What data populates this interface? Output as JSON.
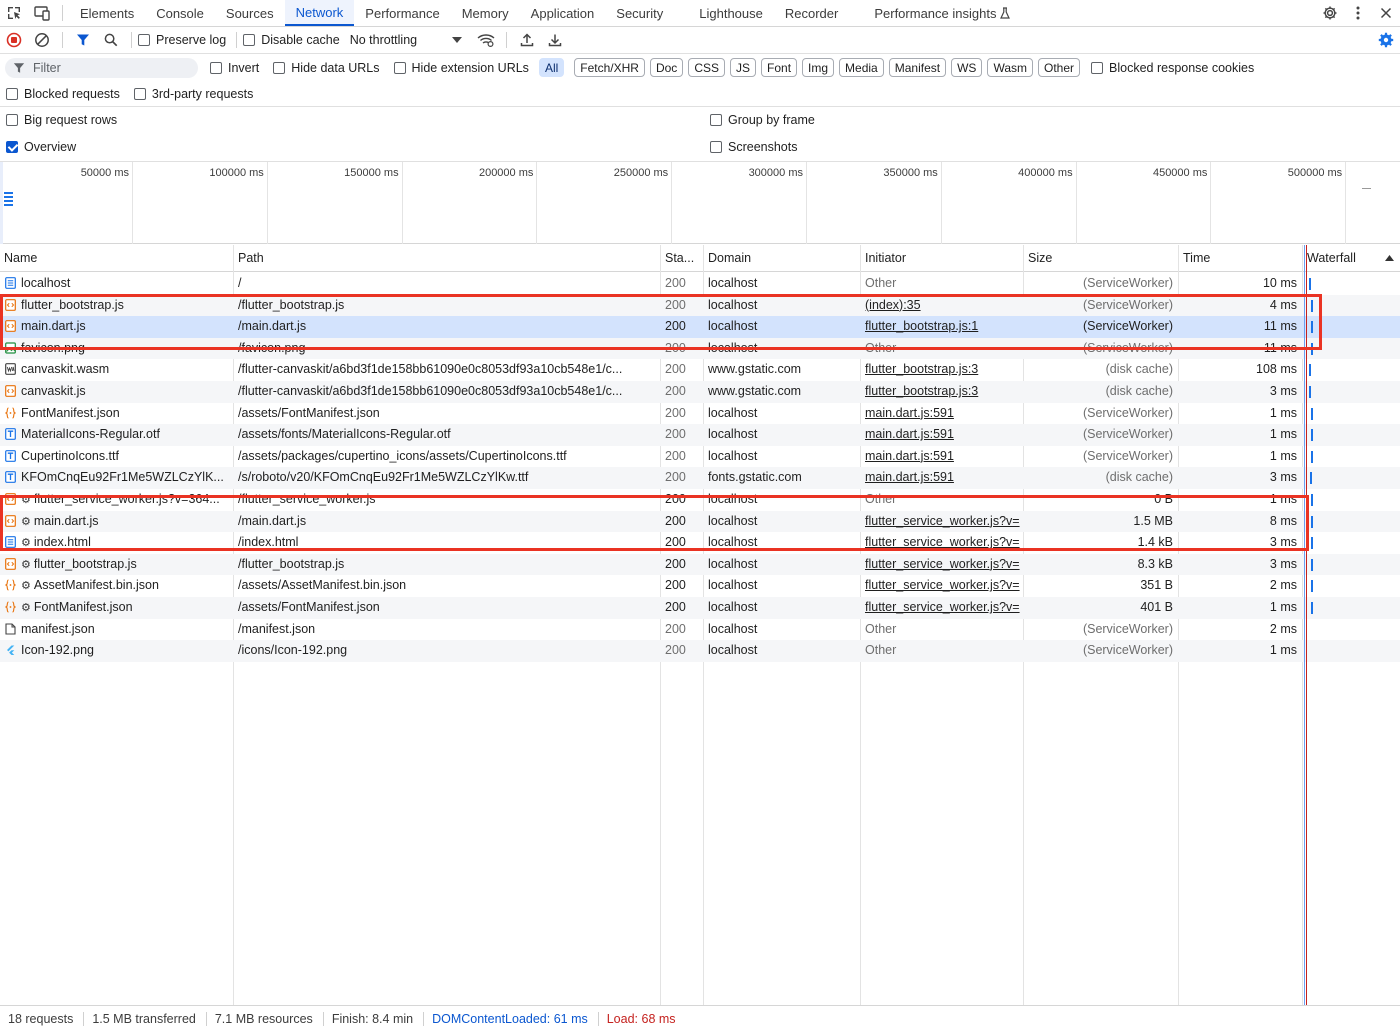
{
  "tabs": [
    "Elements",
    "Console",
    "Sources",
    "Network",
    "Performance",
    "Memory",
    "Application",
    "Security",
    "Lighthouse",
    "Recorder",
    "Performance insights"
  ],
  "active_tab": "Network",
  "toolbar": {
    "preserve_log": "Preserve log",
    "disable_cache": "Disable cache",
    "throttling": "No throttling"
  },
  "filter": {
    "placeholder": "Filter",
    "invert": "Invert",
    "hide_data_urls": "Hide data URLs",
    "hide_extension_urls": "Hide extension URLs",
    "types": [
      "All",
      "Fetch/XHR",
      "Doc",
      "CSS",
      "JS",
      "Font",
      "Img",
      "Media",
      "Manifest",
      "WS",
      "Wasm",
      "Other"
    ],
    "blocked_response_cookies": "Blocked response cookies",
    "blocked_requests": "Blocked requests",
    "third_party_requests": "3rd-party requests"
  },
  "options": {
    "big_request_rows": "Big request rows",
    "group_by_frame": "Group by frame",
    "overview": "Overview",
    "screenshots": "Screenshots"
  },
  "overview_ticks": [
    "50000 ms",
    "100000 ms",
    "150000 ms",
    "200000 ms",
    "250000 ms",
    "300000 ms",
    "350000 ms",
    "400000 ms",
    "450000 ms",
    "500000 ms"
  ],
  "columns": {
    "name": "Name",
    "path": "Path",
    "status": "Sta...",
    "domain": "Domain",
    "initiator": "Initiator",
    "size": "Size",
    "time": "Time",
    "waterfall": "Waterfall"
  },
  "rows": [
    {
      "icon": "doc",
      "sw": false,
      "name": "localhost",
      "path": "/",
      "status": "200",
      "domain": "localhost",
      "initiator": "Other",
      "init_link": false,
      "size": "(ServiceWorker)",
      "time": "10 ms",
      "dim": true
    },
    {
      "icon": "script",
      "sw": false,
      "name": "flutter_bootstrap.js",
      "path": "/flutter_bootstrap.js",
      "status": "200",
      "domain": "localhost",
      "initiator": "(index):35",
      "init_link": true,
      "size": "(ServiceWorker)",
      "time": "4 ms",
      "dim": true
    },
    {
      "icon": "script",
      "sw": false,
      "name": "main.dart.js",
      "path": "/main.dart.js",
      "status": "200",
      "domain": "localhost",
      "initiator": "flutter_bootstrap.js:1",
      "init_link": true,
      "size": "(ServiceWorker)",
      "time": "11 ms",
      "dim": false
    },
    {
      "icon": "img",
      "sw": false,
      "name": "favicon.png",
      "path": "/favicon.png",
      "status": "200",
      "domain": "localhost",
      "initiator": "Other",
      "init_link": false,
      "size": "(ServiceWorker)",
      "time": "11 ms",
      "dim": true
    },
    {
      "icon": "wasm",
      "sw": false,
      "name": "canvaskit.wasm",
      "path": "/flutter-canvaskit/a6bd3f1de158bb61090e0c8053df93a10cb548e1/c...",
      "status": "200",
      "domain": "www.gstatic.com",
      "initiator": "flutter_bootstrap.js:3",
      "init_link": true,
      "size": "(disk cache)",
      "time": "108 ms",
      "dim": true
    },
    {
      "icon": "script",
      "sw": false,
      "name": "canvaskit.js",
      "path": "/flutter-canvaskit/a6bd3f1de158bb61090e0c8053df93a10cb548e1/c...",
      "status": "200",
      "domain": "www.gstatic.com",
      "initiator": "flutter_bootstrap.js:3",
      "init_link": true,
      "size": "(disk cache)",
      "time": "3 ms",
      "dim": true
    },
    {
      "icon": "json",
      "sw": false,
      "name": "FontManifest.json",
      "path": "/assets/FontManifest.json",
      "status": "200",
      "domain": "localhost",
      "initiator": "main.dart.js:591",
      "init_link": true,
      "size": "(ServiceWorker)",
      "time": "1 ms",
      "dim": true
    },
    {
      "icon": "font",
      "sw": false,
      "name": "MaterialIcons-Regular.otf",
      "path": "/assets/fonts/MaterialIcons-Regular.otf",
      "status": "200",
      "domain": "localhost",
      "initiator": "main.dart.js:591",
      "init_link": true,
      "size": "(ServiceWorker)",
      "time": "1 ms",
      "dim": true
    },
    {
      "icon": "font",
      "sw": false,
      "name": "CupertinoIcons.ttf",
      "path": "/assets/packages/cupertino_icons/assets/CupertinoIcons.ttf",
      "status": "200",
      "domain": "localhost",
      "initiator": "main.dart.js:591",
      "init_link": true,
      "size": "(ServiceWorker)",
      "time": "1 ms",
      "dim": true
    },
    {
      "icon": "font",
      "sw": false,
      "name": "KFOmCnqEu92Fr1Me5WZLCzYlK...",
      "path": "/s/roboto/v20/KFOmCnqEu92Fr1Me5WZLCzYlKw.ttf",
      "status": "200",
      "domain": "fonts.gstatic.com",
      "initiator": "main.dart.js:591",
      "init_link": true,
      "size": "(disk cache)",
      "time": "3 ms",
      "dim": true
    },
    {
      "icon": "script",
      "sw": true,
      "name": "flutter_service_worker.js?v=364...",
      "path": "/flutter_service_worker.js",
      "status": "200",
      "domain": "localhost",
      "initiator": "Other",
      "init_link": false,
      "size": "0 B",
      "time": "1 ms",
      "dim": false
    },
    {
      "icon": "script",
      "sw": true,
      "name": "main.dart.js",
      "path": "/main.dart.js",
      "status": "200",
      "domain": "localhost",
      "initiator": "flutter_service_worker.js?v=",
      "init_link": true,
      "size": "1.5 MB",
      "time": "8 ms",
      "dim": false
    },
    {
      "icon": "doc",
      "sw": true,
      "name": "index.html",
      "path": "/index.html",
      "status": "200",
      "domain": "localhost",
      "initiator": "flutter_service_worker.js?v=",
      "init_link": true,
      "size": "1.4 kB",
      "time": "3 ms",
      "dim": false
    },
    {
      "icon": "script",
      "sw": true,
      "name": "flutter_bootstrap.js",
      "path": "/flutter_bootstrap.js",
      "status": "200",
      "domain": "localhost",
      "initiator": "flutter_service_worker.js?v=",
      "init_link": true,
      "size": "8.3 kB",
      "time": "3 ms",
      "dim": false
    },
    {
      "icon": "json",
      "sw": true,
      "name": "AssetManifest.bin.json",
      "path": "/assets/AssetManifest.bin.json",
      "status": "200",
      "domain": "localhost",
      "initiator": "flutter_service_worker.js?v=",
      "init_link": true,
      "size": "351 B",
      "time": "2 ms",
      "dim": false
    },
    {
      "icon": "json",
      "sw": true,
      "name": "FontManifest.json",
      "path": "/assets/FontManifest.json",
      "status": "200",
      "domain": "localhost",
      "initiator": "flutter_service_worker.js?v=",
      "init_link": true,
      "size": "401 B",
      "time": "1 ms",
      "dim": false
    },
    {
      "icon": "manifest",
      "sw": false,
      "name": "manifest.json",
      "path": "/manifest.json",
      "status": "200",
      "domain": "localhost",
      "initiator": "Other",
      "init_link": false,
      "size": "(ServiceWorker)",
      "time": "2 ms",
      "dim": true
    },
    {
      "icon": "img-flutter",
      "sw": false,
      "name": "Icon-192.png",
      "path": "/icons/Icon-192.png",
      "status": "200",
      "domain": "localhost",
      "initiator": "Other",
      "init_link": false,
      "size": "(ServiceWorker)",
      "time": "1 ms",
      "dim": true
    }
  ],
  "status_bar": {
    "requests": "18 requests",
    "transferred": "1.5 MB transferred",
    "resources": "7.1 MB resources",
    "finish": "Finish: 8.4 min",
    "dom_content_loaded": "DOMContentLoaded: 61 ms",
    "load": "Load: 68 ms"
  },
  "colors": {
    "accent": "#0b57d0",
    "selected_row": "#d3e3fd",
    "highlight_box": "#ea3323",
    "script_icon": "#e8710a",
    "doc_icon": "#1a73e8"
  }
}
